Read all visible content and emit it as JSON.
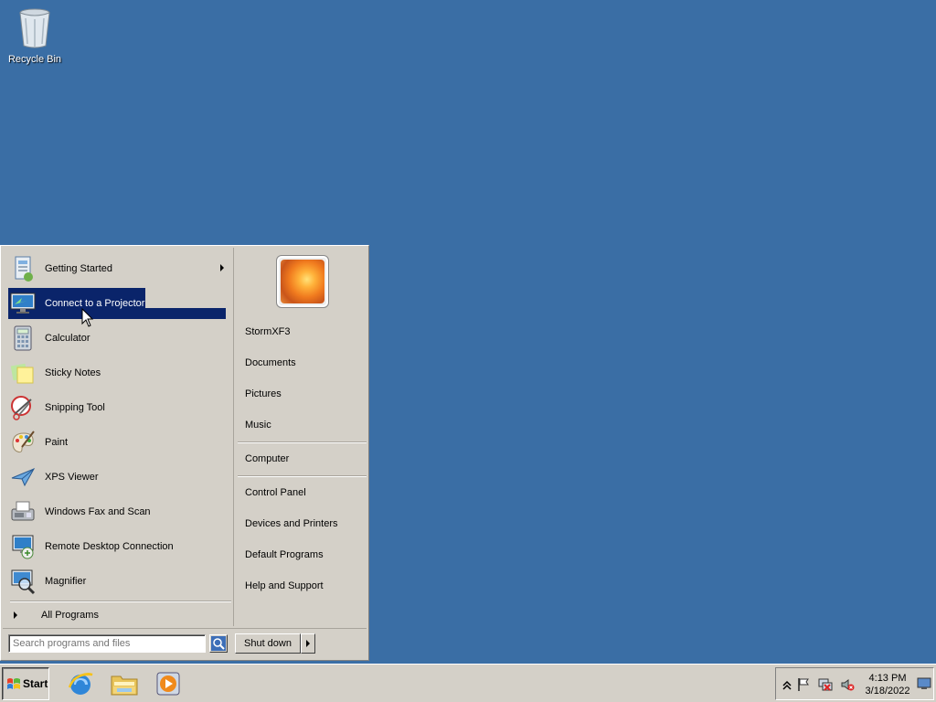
{
  "desktop": {
    "recycle_bin_label": "Recycle Bin"
  },
  "start_menu": {
    "programs": [
      {
        "label": "Getting Started",
        "icon": "getting-started-icon",
        "has_submenu": true
      },
      {
        "label": "Connect to a Projector",
        "icon": "projector-icon",
        "selected": true
      },
      {
        "label": "Calculator",
        "icon": "calculator-icon"
      },
      {
        "label": "Sticky Notes",
        "icon": "sticky-notes-icon"
      },
      {
        "label": "Snipping Tool",
        "icon": "snipping-tool-icon"
      },
      {
        "label": "Paint",
        "icon": "paint-icon"
      },
      {
        "label": "XPS Viewer",
        "icon": "xps-viewer-icon"
      },
      {
        "label": "Windows Fax and Scan",
        "icon": "fax-scan-icon"
      },
      {
        "label": "Remote Desktop Connection",
        "icon": "remote-desktop-icon"
      },
      {
        "label": "Magnifier",
        "icon": "magnifier-icon"
      }
    ],
    "all_programs_label": "All Programs",
    "right_items": [
      {
        "label": "StormXF3"
      },
      {
        "label": "Documents"
      },
      {
        "label": "Pictures"
      },
      {
        "label": "Music"
      },
      {
        "label": "Computer"
      },
      {
        "label": "Control Panel"
      },
      {
        "label": "Devices and Printers"
      },
      {
        "label": "Default Programs"
      },
      {
        "label": "Help and Support"
      }
    ],
    "search_placeholder": "Search programs and files",
    "shutdown_label": "Shut down"
  },
  "taskbar": {
    "start_label": "Start",
    "quick_launch": [
      "internet-explorer-icon",
      "windows-explorer-icon",
      "media-player-icon"
    ],
    "tray_icons": [
      "show-hidden-icons-icon",
      "action-center-flag-icon",
      "network-icon",
      "volume-muted-icon"
    ],
    "time": "4:13 PM",
    "date": "3/18/2022"
  },
  "colors": {
    "desktop": "#3a6ea5",
    "menu_bg": "#d4d0c8",
    "selection": "#0a246a"
  }
}
